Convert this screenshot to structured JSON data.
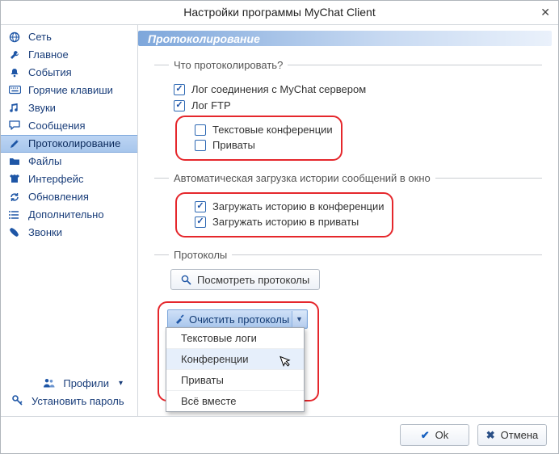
{
  "title": "Настройки программы MyChat Client",
  "sidebar": {
    "items": [
      {
        "icon": "globe-icon",
        "label": "Сеть",
        "active": false
      },
      {
        "icon": "wrench-icon",
        "label": "Главное",
        "active": false
      },
      {
        "icon": "bell-icon",
        "label": "События",
        "active": false
      },
      {
        "icon": "keyboard-icon",
        "label": "Горячие клавиши",
        "active": false
      },
      {
        "icon": "music-icon",
        "label": "Звуки",
        "active": false
      },
      {
        "icon": "chat-icon",
        "label": "Сообщения",
        "active": false
      },
      {
        "icon": "pencil-icon",
        "label": "Протоколирование",
        "active": true
      },
      {
        "icon": "folder-icon",
        "label": "Файлы",
        "active": false
      },
      {
        "icon": "shirt-icon",
        "label": "Интерфейс",
        "active": false
      },
      {
        "icon": "refresh-icon",
        "label": "Обновления",
        "active": false
      },
      {
        "icon": "list-icon",
        "label": "Дополнительно",
        "active": false
      },
      {
        "icon": "phone-icon",
        "label": "Звонки",
        "active": false
      }
    ],
    "profiles_label": "Профили",
    "set_password_label": "Установить пароль"
  },
  "page": {
    "header": "Протоколирование",
    "group1": {
      "title": "Что протоколировать?",
      "opts": [
        {
          "label": "Лог соединения с MyChat сервером",
          "checked": true
        },
        {
          "label": "Лог FTP",
          "checked": true
        }
      ],
      "highlight": [
        {
          "label": "Текстовые конференции",
          "checked": false
        },
        {
          "label": "Приваты",
          "checked": false
        }
      ]
    },
    "group2": {
      "title": "Автоматическая загрузка истории сообщений в окно",
      "highlight": [
        {
          "label": "Загружать историю в конференции",
          "checked": true
        },
        {
          "label": "Загружать историю в приваты",
          "checked": true
        }
      ]
    },
    "group3": {
      "title": "Протоколы",
      "view_button": "Посмотреть протоколы",
      "clear_button": "Очистить протоколы",
      "menu": [
        "Текстовые логи",
        "Конференции",
        "Приваты",
        "Всё вместе"
      ],
      "menu_hover_index": 1
    }
  },
  "footer": {
    "ok": "Ok",
    "cancel": "Отмена"
  }
}
